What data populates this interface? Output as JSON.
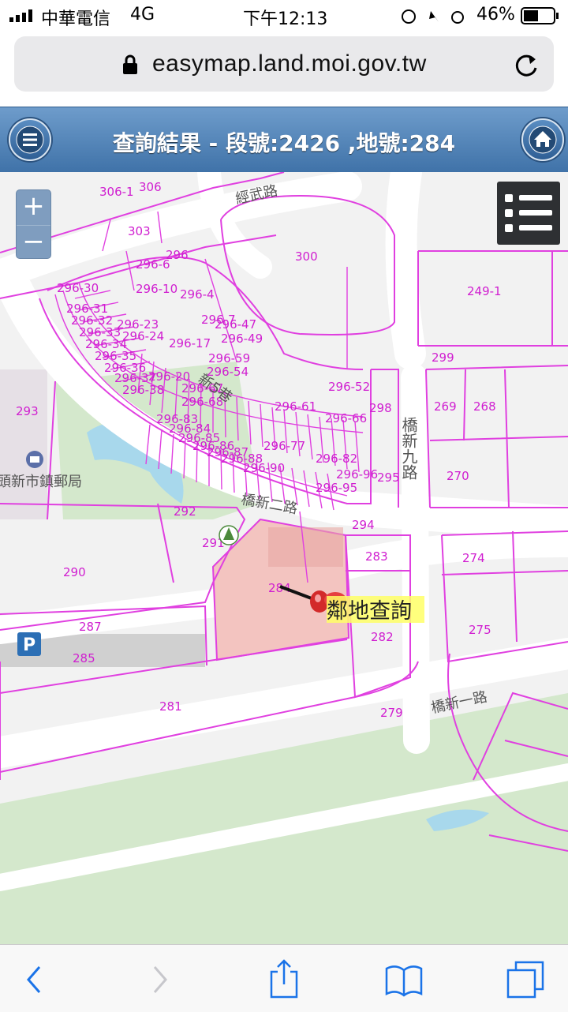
{
  "status_bar": {
    "carrier": "中華電信",
    "network": "4G",
    "time": "下午12:13",
    "battery": "46%"
  },
  "browser": {
    "url": "easymap.land.moi.gov.tw"
  },
  "header": {
    "title": "查詢結果 - 段號:2426 ,地號:284"
  },
  "map": {
    "zoom_in": "+",
    "zoom_out": "−",
    "roads": {
      "jingwu": "經武路",
      "qiaoxin2": "橋新二路",
      "qiaoxin1": "橋新一路",
      "qiaoxin9": "橋新九路",
      "xin5": "新5巷"
    },
    "post_office": "頭新市鎮郵局",
    "parking": "P",
    "selected_parcel": "284",
    "neighbor_query": "鄰地查詢",
    "parcels": [
      "306-1",
      "306",
      "303",
      "300",
      "249-1",
      "296",
      "296-6",
      "296-31",
      "296-32",
      "296-33",
      "296-34",
      "296-35",
      "296-36",
      "296-37",
      "296-38",
      "296-30",
      "296-10",
      "296-4",
      "296-23",
      "296-24",
      "296-17",
      "296-20",
      "296-7",
      "296-47",
      "296-49",
      "296-52",
      "296-54",
      "296-59",
      "296-61",
      "296-66",
      "296-67",
      "296-68",
      "296-77",
      "296-82",
      "296-83",
      "296-84",
      "296-85",
      "296-86",
      "296-87",
      "296-88",
      "296-90",
      "296-95",
      "296-96",
      "298",
      "299",
      "269",
      "268",
      "270",
      "295",
      "294",
      "293",
      "292",
      "291",
      "290",
      "287",
      "285",
      "281",
      "283",
      "282",
      "274",
      "275",
      "279"
    ]
  },
  "colors": {
    "parcel_line": "#e040e0",
    "header_top": "#6e9ccb",
    "header_bottom": "#3f72a8",
    "selected_fill": "#f3c4c0",
    "green_space": "#d4e8cc",
    "water": "#a8d8ec"
  }
}
